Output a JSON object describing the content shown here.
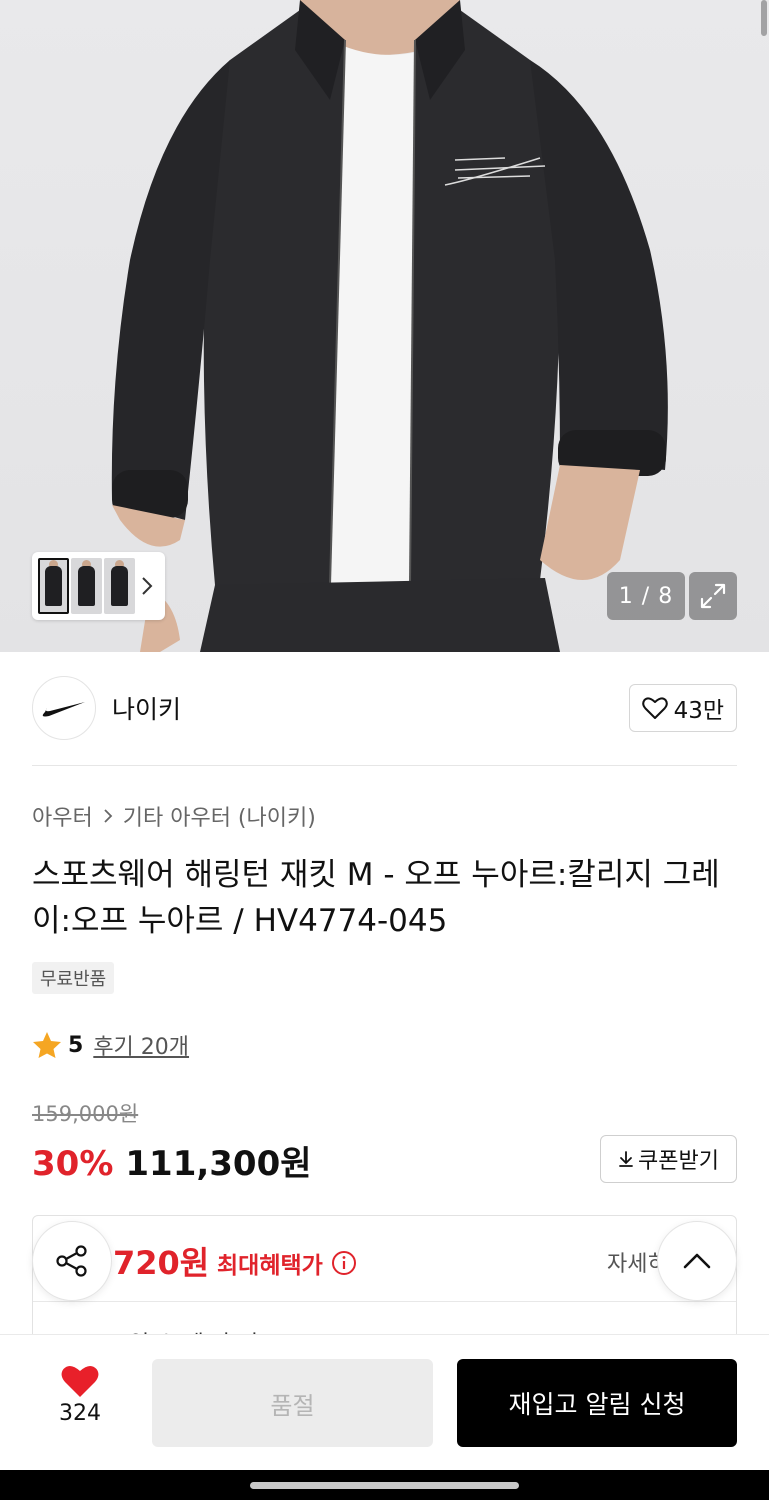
{
  "gallery": {
    "page_counter": "1 / 8"
  },
  "brand": {
    "name": "나이키",
    "like_count": "43만"
  },
  "breadcrumb": {
    "level1": "아우터",
    "level2": "기타 아우터 (나이키)"
  },
  "product": {
    "title": "스포츠웨어 해링턴 재킷 M - 오프 누아르:칼리지 그레이:오프 누아르 / HV4774-045",
    "badge": "무료반품",
    "rating": "5",
    "review_link": "후기 20개"
  },
  "pricing": {
    "original_price": "159,000원",
    "discount_rate": "30%",
    "sale_price": "111,300원",
    "coupon_button": "쿠폰받기"
  },
  "benefit": {
    "max_benefit_price": "720원",
    "max_benefit_label": "최대혜택가",
    "detail_link": "자세히",
    "partial_row_text": "잊 쇼 세 가 기"
  },
  "bottom_bar": {
    "wish_count": "324",
    "soldout_label": "품절",
    "restock_label": "재입고 알림 신청"
  },
  "colors": {
    "accent_red": "#e0232b",
    "primary_black": "#000000",
    "soldout_gray": "#ececec"
  }
}
